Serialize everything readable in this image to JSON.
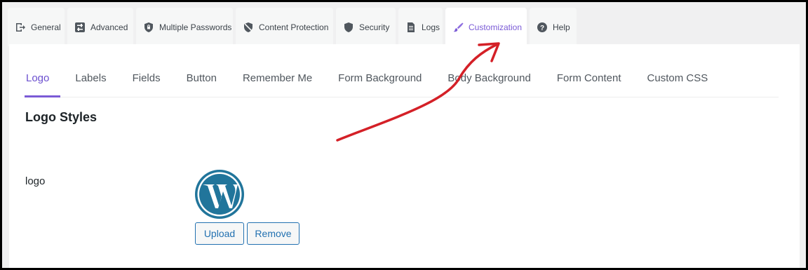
{
  "top_tabs": [
    {
      "label": "General",
      "icon": "exit-icon"
    },
    {
      "label": "Advanced",
      "icon": "sliders-icon"
    },
    {
      "label": "Multiple Passwords",
      "icon": "shield-icon"
    },
    {
      "label": "Content Protection",
      "icon": "shield-slash-icon"
    },
    {
      "label": "Security",
      "icon": "shield-icon"
    },
    {
      "label": "Logs",
      "icon": "document-icon"
    },
    {
      "label": "Customization",
      "icon": "brush-icon",
      "active": true
    },
    {
      "label": "Help",
      "icon": "question-icon"
    }
  ],
  "sub_tabs": [
    {
      "label": "Logo",
      "active": true
    },
    {
      "label": "Labels"
    },
    {
      "label": "Fields"
    },
    {
      "label": "Button"
    },
    {
      "label": "Remember Me"
    },
    {
      "label": "Form Background"
    },
    {
      "label": "Body Background"
    },
    {
      "label": "Form Content"
    },
    {
      "label": "Custom CSS"
    }
  ],
  "section": {
    "title": "Logo Styles"
  },
  "logo_field": {
    "label": "logo",
    "image_icon": "wordpress-logo-icon",
    "upload_label": "Upload",
    "remove_label": "Remove"
  },
  "colors": {
    "accent": "#7b5bd6",
    "link_blue": "#2271b1",
    "wp_blue": "#21759b",
    "annotation_red": "#d42027"
  }
}
